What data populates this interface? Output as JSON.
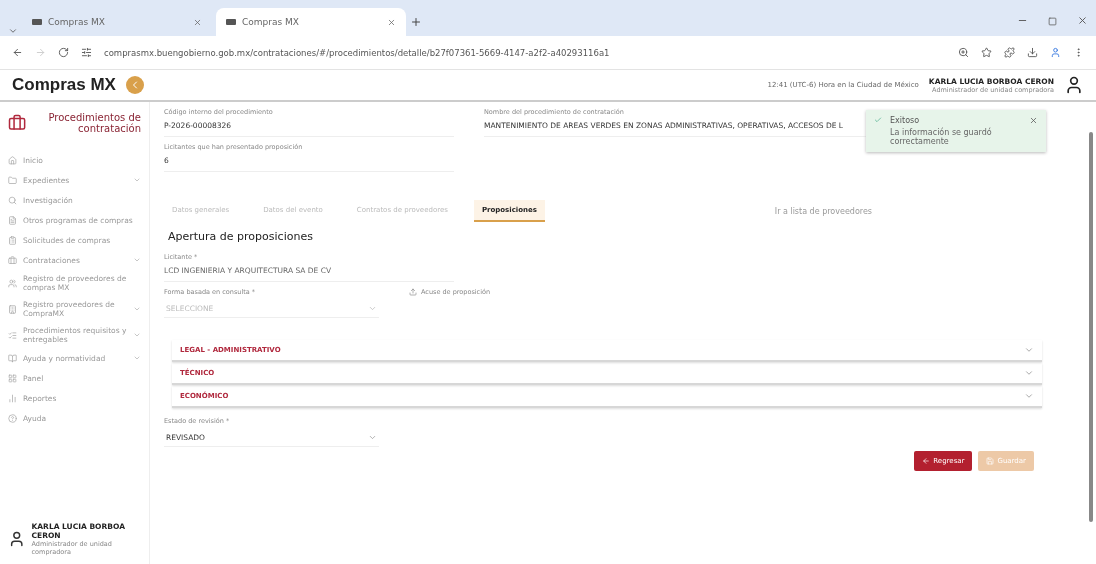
{
  "browser": {
    "tabs": [
      {
        "label": "Compras MX",
        "selected": false
      },
      {
        "label": "Compras MX",
        "selected": true
      }
    ],
    "url": "comprasmx.buengobierno.gob.mx/contrataciones/#/procedimientos/detalle/b27f07361-5669-4147-a2f2-a40293116a1"
  },
  "header": {
    "logo": "Compras MX",
    "time": "12:41 (UTC-6) Hora en la Ciudad de México",
    "user_name": "KARLA LUCIA BORBOA CERON",
    "user_role": "Administrador de unidad compradora"
  },
  "sidebar": {
    "title": "Procedimientos de contratación",
    "items": [
      {
        "label": "Inicio",
        "expandable": false
      },
      {
        "label": "Expedientes",
        "expandable": true
      },
      {
        "label": "Investigación",
        "expandable": false
      },
      {
        "label": "Otros programas de compras",
        "expandable": false
      },
      {
        "label": "Solicitudes de compras",
        "expandable": false
      },
      {
        "label": "Contrataciones",
        "expandable": true
      },
      {
        "label": "Registro de proveedores de compras MX",
        "expandable": false
      },
      {
        "label": "Registro proveedores de CompraMX",
        "expandable": true
      },
      {
        "label": "Procedimientos requisitos y entregables",
        "expandable": true
      },
      {
        "label": "Ayuda y normatividad",
        "expandable": true
      },
      {
        "label": "Panel",
        "expandable": false
      },
      {
        "label": "Reportes",
        "expandable": false
      },
      {
        "label": "Ayuda",
        "expandable": false
      }
    ],
    "user_name": "KARLA LUCIA BORBOA CERON",
    "user_role": "Administrador de unidad compradora"
  },
  "fields": [
    {
      "label": "Código interno del procedimiento",
      "value": "P-2026-00008326"
    },
    {
      "label": "Nombre del procedimiento de contratación",
      "value": "MANTENIMIENTO DE AREAS VERDES EN ZONAS ADMINISTRATIVAS, OPERATIVAS, ACCESOS DE L"
    },
    {
      "label": "Licitantes que han presentado proposición",
      "value": "6"
    }
  ],
  "toast": {
    "title": "Exitoso",
    "message": "La información se guardó correctamente"
  },
  "tabs": [
    {
      "label": "Datos generales",
      "selected": false
    },
    {
      "label": "Datos del evento",
      "selected": false
    },
    {
      "label": "Contratos de proveedores",
      "selected": false
    },
    {
      "label": "Proposiciones",
      "selected": true
    }
  ],
  "tabs_link": "Ir a lista de proveedores",
  "section_title": "Apertura de proposiciones",
  "bidder": {
    "label": "Licitante *",
    "value": "LCD INGENIERIA Y ARQUITECTURA SA DE CV"
  },
  "form_select": {
    "label": "Forma basada en consulta *",
    "placeholder": "SELECCIONE"
  },
  "receipt_link": "Acuse de proposición",
  "accordions": [
    {
      "label": "LEGAL - ADMINISTRATIVO",
      "expanded": false
    },
    {
      "label": "TÉCNICO",
      "expanded": false
    },
    {
      "label": "ECONÓMICO",
      "expanded": false
    }
  ],
  "status_select": {
    "label": "Estado de revisión *",
    "value": "REVISADO"
  },
  "buttons": [
    {
      "label": "Regresar",
      "kind": "back",
      "disabled": false
    },
    {
      "label": "Guardar",
      "kind": "save",
      "disabled": true
    }
  ]
}
